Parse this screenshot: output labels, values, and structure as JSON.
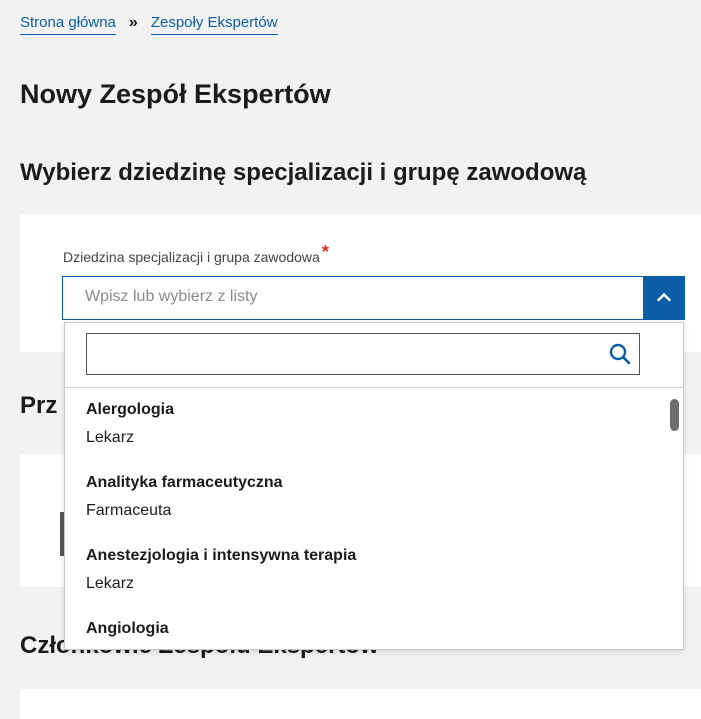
{
  "breadcrumb": {
    "home": "Strona główna",
    "separator": "»",
    "current": "Zespoły Ekspertów"
  },
  "page_title": "Nowy Zespół Ekspertów",
  "section_specialization": {
    "title": "Wybierz dziedzinę specjalizacji i grupę zawodową",
    "field_label": "Dziedzina specjalizacji i grupa zawodowa",
    "required_mark": "*",
    "placeholder": "Wpisz lub wybierz z listy",
    "toggle_icon": "chevron-up-icon",
    "dropdown": {
      "search_value": "",
      "search_icon": "search-icon",
      "options": [
        {
          "name": "Alergologia",
          "group": "Lekarz"
        },
        {
          "name": "Analityka farmaceutyczna",
          "group": "Farmaceuta"
        },
        {
          "name": "Anestezjologia i intensywna terapia",
          "group": "Lekarz"
        },
        {
          "name": "Angiologia",
          "group": ""
        }
      ]
    }
  },
  "section_2": {
    "title_visible_fragment": "Prz"
  },
  "section_members": {
    "title": "Członkowie Zespołu Ekspertów"
  },
  "colors": {
    "accent": "#0b5ea6",
    "required": "#d4351c",
    "background": "#f2f2f2",
    "panel": "#ffffff"
  }
}
